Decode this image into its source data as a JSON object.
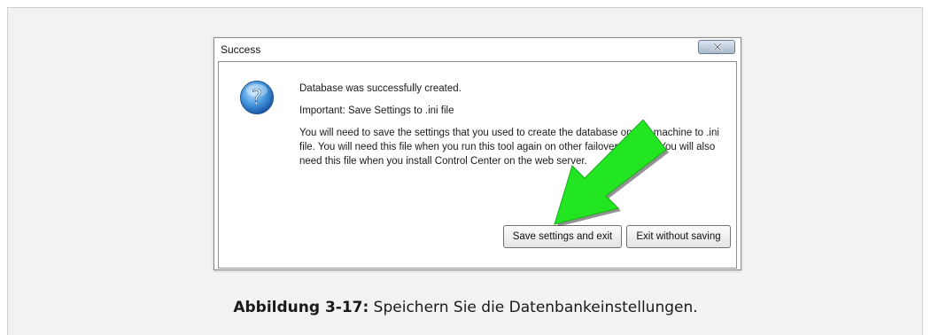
{
  "dialog": {
    "title": "Success",
    "close_label": "×",
    "icon": "question-icon",
    "message": "Database was successfully created.",
    "important": "Important: Save Settings to .ini file",
    "details": "You will need to save the settings that you used to create the database on this machine to .ini file. You will need this file when you run this tool again on other failover servers. You will also need this file when you install Control Center on the web server.",
    "buttons": {
      "save": "Save settings and exit",
      "exit": "Exit without saving"
    }
  },
  "annotation": {
    "arrow_color": "#22e622"
  },
  "caption": {
    "label": "Abbildung 3-17:",
    "text": " Speichern Sie die Datenbankeinstellungen."
  }
}
